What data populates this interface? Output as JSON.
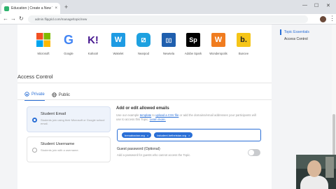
{
  "browser": {
    "tab_title": "Education | Create a New Topic",
    "url": "admin.flipgrid.com/manage/topic/new",
    "new_tab": "+",
    "close_tab": "×"
  },
  "integrations": [
    {
      "label": "Microsoft",
      "glyph": "",
      "color": "#ffffff"
    },
    {
      "label": "Google",
      "glyph": "G",
      "color": "#4285f4"
    },
    {
      "label": "Kahoot!",
      "glyph": "K!",
      "color": "#46178f"
    },
    {
      "label": "Wakelet",
      "glyph": "W",
      "color": "#1e9be3"
    },
    {
      "label": "Nearpod",
      "glyph": "⧄",
      "color": "#1ea1e0"
    },
    {
      "label": "Newsela",
      "glyph": "▯▯",
      "color": "#1f5fae"
    },
    {
      "label": "Adobe Spark",
      "glyph": "Sp",
      "color": "#000000"
    },
    {
      "label": "Wonderopolis",
      "glyph": "W",
      "color": "#f07c1f"
    },
    {
      "label": "Buncee",
      "glyph": "b.",
      "color": "#f5c518"
    }
  ],
  "access": {
    "title": "Access Control",
    "tabs": [
      {
        "label": "Private",
        "icon": "lock-icon",
        "active": true
      },
      {
        "label": "Public",
        "icon": "globe-icon",
        "active": false
      }
    ],
    "options": [
      {
        "title": "Student Email",
        "desc": "Students join using their Microsoft or Google school email."
      },
      {
        "title": "Student Username",
        "desc": "Students join with a username."
      }
    ],
    "emails_heading": "Add or edit allowed emails",
    "emails_desc_1": "Use our example ",
    "emails_link_1": "template",
    "emails_desc_2": " to ",
    "emails_link_2": "upload a CSV file",
    "emails_desc_3": " or add the domains/email addresses your participants will use to access this Topic. ",
    "emails_link_3": "Learn more.",
    "chips": [
      "bresabactan.org",
      "bstudent.bethelstan.org"
    ],
    "guest_heading": "Guest password (Optional)",
    "guest_desc": "Add a password for guests who cannot access the Topic."
  },
  "sidebar": {
    "items": [
      {
        "label": "Topic Essentials",
        "active": true
      },
      {
        "label": "Access Control",
        "active": false
      }
    ]
  },
  "colors": {
    "accent": "#2a6fd6"
  }
}
